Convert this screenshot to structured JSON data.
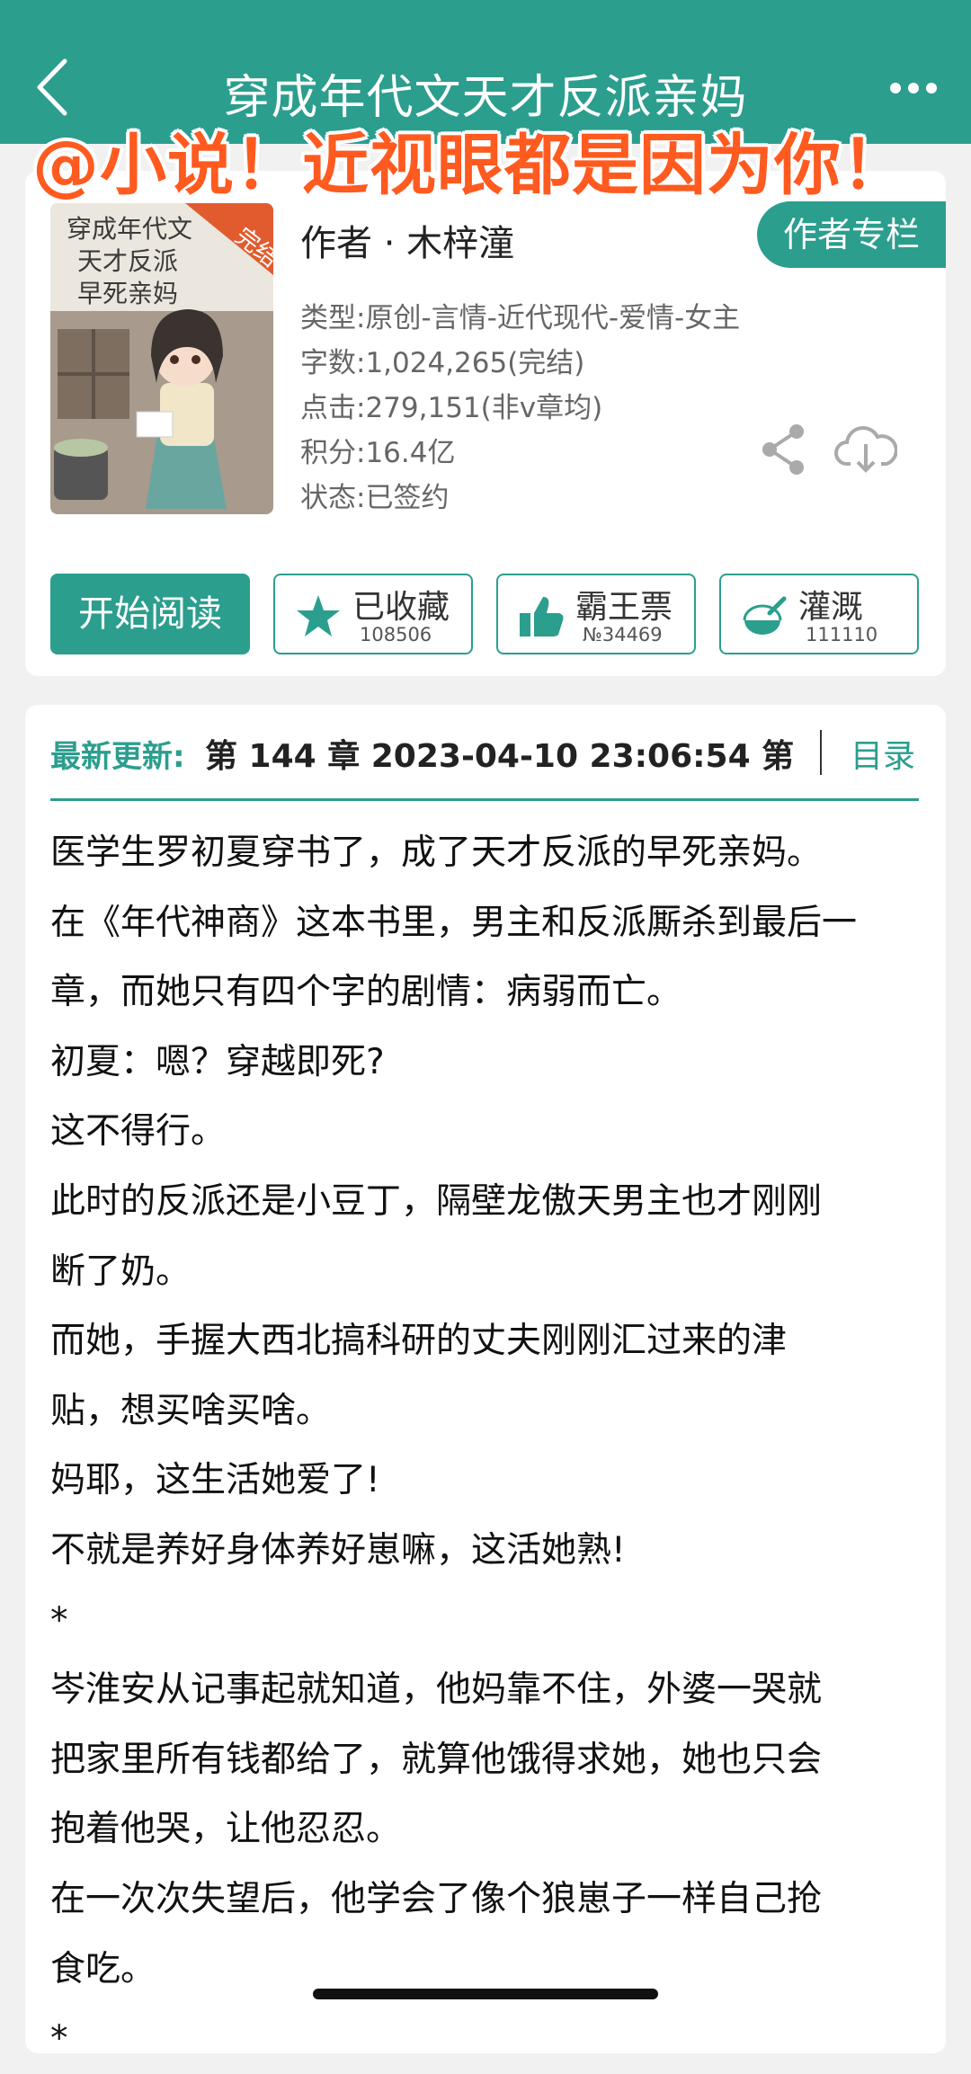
{
  "header": {
    "title": "穿成年代文天才反派亲妈",
    "back_icon": "back-chevron-icon",
    "more_icon": "more-dots-icon",
    "bg_color": "#2b9e8e"
  },
  "watermark": "@小说！近视眼都是因为你！",
  "book": {
    "cover": {
      "title_lines": [
        "穿成年代文",
        "天才反派",
        "早死亲妈"
      ],
      "ribbon": "完结"
    },
    "author": "作者 · 木梓潼",
    "author_column_label": "作者专栏",
    "type": "类型:原创-言情-近代现代-爱情-女主",
    "words": "字数:1,024,265(完结)",
    "clicks": "点击:279,151(非v章均)",
    "score": "积分:16.4亿",
    "status": "状态:已签约",
    "share_icon": "share-icon",
    "download_icon": "cloud-download-icon"
  },
  "actions": {
    "read": "开始阅读",
    "collect": {
      "label": "已收藏",
      "count": "108506",
      "icon": "star-icon"
    },
    "vote": {
      "label": "霸王票",
      "count": "№34469",
      "icon": "thumbs-up-icon"
    },
    "water": {
      "label": "灌溉",
      "count": "111110",
      "icon": "nutrient-flask-icon"
    }
  },
  "update": {
    "label": "最新更新:",
    "text": "第 144 章 2023-04-10 23:06:54 第",
    "toc": "目录"
  },
  "synopsis": [
    "医学生罗初夏穿书了，成了天才反派的早死亲妈。",
    "在《年代神商》这本书里，男主和反派厮杀到最后一",
    "章，而她只有四个字的剧情：病弱而亡。",
    "初夏：嗯？穿越即死?",
    "这不得行。",
    "此时的反派还是小豆丁，隔壁龙傲天男主也才刚刚",
    "断了奶。",
    "而她，手握大西北搞科研的丈夫刚刚汇过来的津",
    "贴，想买啥买啥。",
    "妈耶，这生活她爱了!",
    "不就是养好身体养好崽嘛，这活她熟!",
    "*",
    "岑淮安从记事起就知道，他妈靠不住，外婆一哭就",
    "把家里所有钱都给了，就算他饿得求她，她也只会",
    "抱着他哭，让他忍忍。",
    "在一次次失望后，他学会了像个狼崽子一样自己抢",
    "食吃。",
    "*"
  ]
}
